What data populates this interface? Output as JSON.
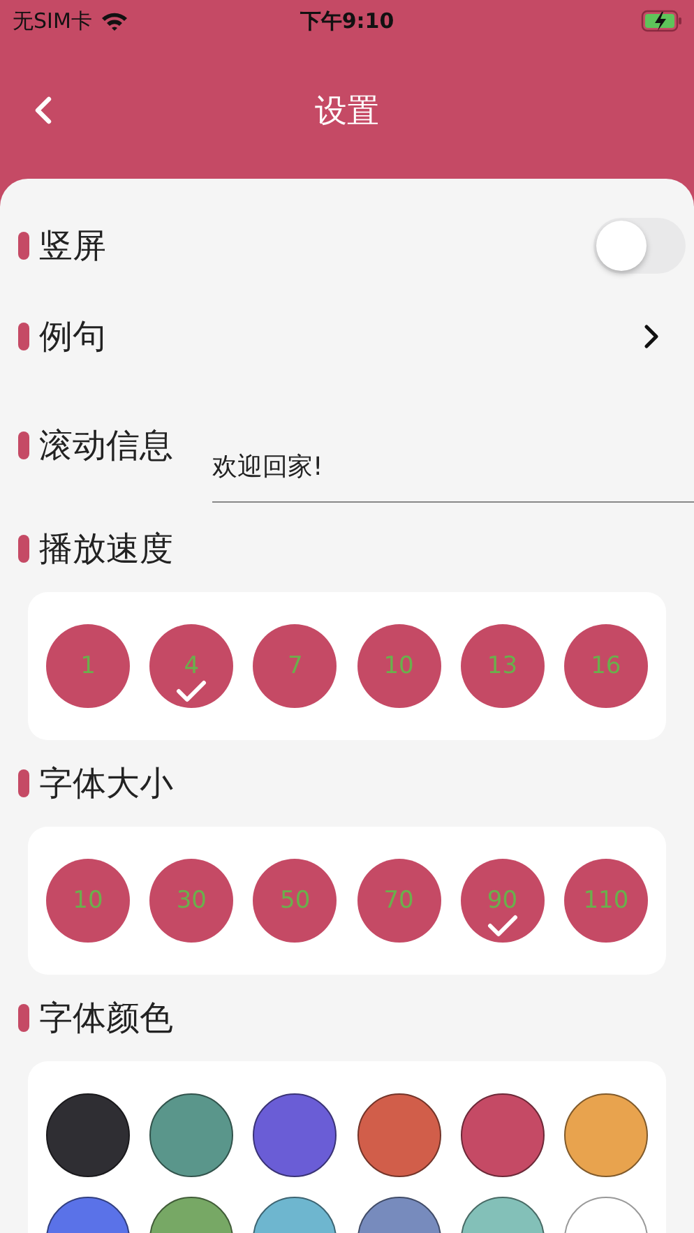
{
  "status_bar": {
    "carrier": "无SIM卡",
    "time": "下午9:10",
    "charging": true
  },
  "header": {
    "title": "设置"
  },
  "settings": [
    {
      "kind": "toggle",
      "label": "竖屏",
      "on": false
    },
    {
      "kind": "link",
      "label": "例句"
    },
    {
      "kind": "input",
      "label": "滚动信息",
      "value": "欢迎回家!"
    }
  ],
  "speed": {
    "label": "播放速度",
    "options": [
      {
        "label": "1",
        "selected": false
      },
      {
        "label": "4",
        "selected": true
      },
      {
        "label": "7",
        "selected": false
      },
      {
        "label": "10",
        "selected": false
      },
      {
        "label": "13",
        "selected": false
      },
      {
        "label": "16",
        "selected": false
      }
    ]
  },
  "font_size": {
    "label": "字体大小",
    "options": [
      {
        "label": "10",
        "selected": false
      },
      {
        "label": "30",
        "selected": false
      },
      {
        "label": "50",
        "selected": false
      },
      {
        "label": "70",
        "selected": false
      },
      {
        "label": "90",
        "selected": true
      },
      {
        "label": "110",
        "selected": false
      }
    ]
  },
  "font_color": {
    "label": "字体颜色",
    "options": [
      {
        "color": "#2f2e33"
      },
      {
        "color": "#5a968b"
      },
      {
        "color": "#6a5dd6"
      },
      {
        "color": "#d15e4a"
      },
      {
        "color": "#c54a65"
      },
      {
        "color": "#e8a34e"
      },
      {
        "color": "#5a72e8"
      },
      {
        "color": "#77a865"
      },
      {
        "color": "#6eb6cf"
      },
      {
        "color": "#778bbd"
      },
      {
        "color": "#83c0b8"
      },
      {
        "color": "#ffffff"
      }
    ]
  }
}
